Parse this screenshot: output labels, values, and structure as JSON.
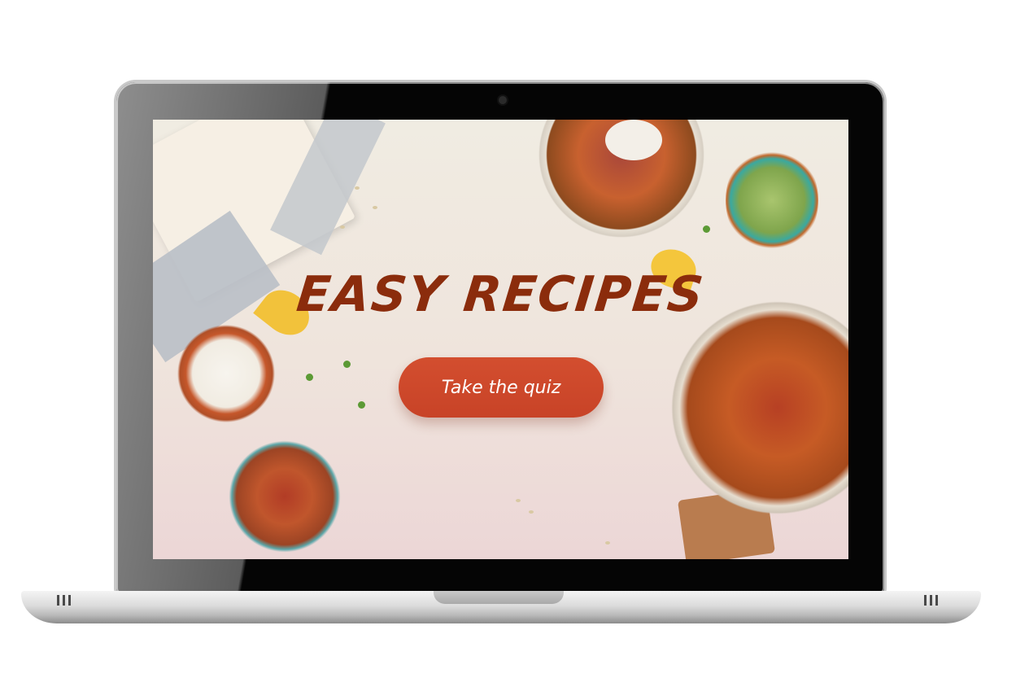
{
  "hero": {
    "title": "EASY RECIPES",
    "cta_label": "Take the quiz"
  },
  "colors": {
    "title": "#8b2c0c",
    "cta_background": "#cc4a2c",
    "cta_text": "#ffffff",
    "screen_background": "#f0ece2"
  },
  "icons": {
    "camera": "camera-icon"
  }
}
